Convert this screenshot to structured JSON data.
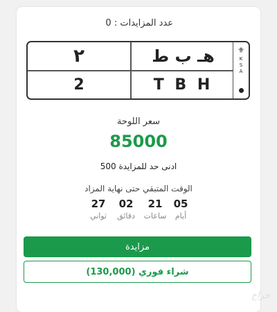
{
  "bids": {
    "label": "عدد المزايدات : 0"
  },
  "plate": {
    "arabic_letters": "هـ ب ط",
    "arabic_number": "٢",
    "latin_letters": "T B H",
    "latin_number": "2",
    "emblem": "⚜",
    "country": "K\nS\nA"
  },
  "price": {
    "label": "سعر اللوحة",
    "value": "85000"
  },
  "min_bid": {
    "text": "ادنى حد للمزايدة 500"
  },
  "countdown": {
    "label": "الوقت المتبقي حتى نهاية المزاد",
    "days": {
      "value": "05",
      "unit": "أيام"
    },
    "hours": {
      "value": "21",
      "unit": "ساعات"
    },
    "minutes": {
      "value": "02",
      "unit": "دقائق"
    },
    "seconds": {
      "value": "27",
      "unit": "ثواني"
    }
  },
  "buttons": {
    "bid": "مزايدة",
    "buy_now": "شراء فوري (130,000)"
  },
  "watermark": "حراج",
  "colors": {
    "accent": "#1b9a4b",
    "price": "#1e9a4c"
  }
}
